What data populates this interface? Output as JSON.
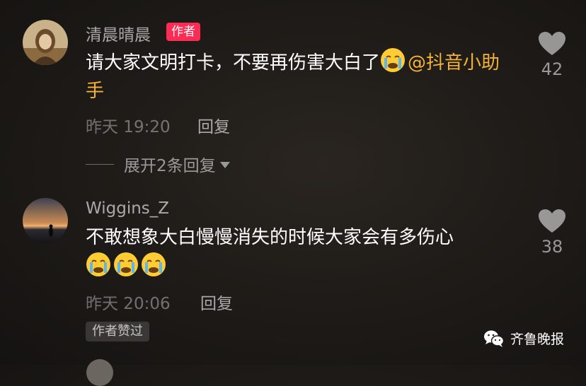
{
  "comments": [
    {
      "username": "清晨晴晨",
      "author_badge": "作者",
      "text": "请大家文明打卡，不要再伤害大白了",
      "mention": "@抖音小助手",
      "time": "昨天 19:20",
      "reply_label": "回复",
      "likes": "42",
      "expand_label": "展开2条回复"
    },
    {
      "username": "Wiggins_Z",
      "text": "不敢想象大白慢慢消失的时候大家会有多伤心",
      "time": "昨天 20:06",
      "reply_label": "回复",
      "likes": "38",
      "author_liked": "作者赞过"
    }
  ],
  "watermark": "齐鲁晚报",
  "icons": [
    "heart-icon",
    "crying-emoji",
    "wechat-icon",
    "caret-down-icon"
  ],
  "colors": {
    "author_badge": "#fe2c55",
    "mention": "#f5b335"
  }
}
